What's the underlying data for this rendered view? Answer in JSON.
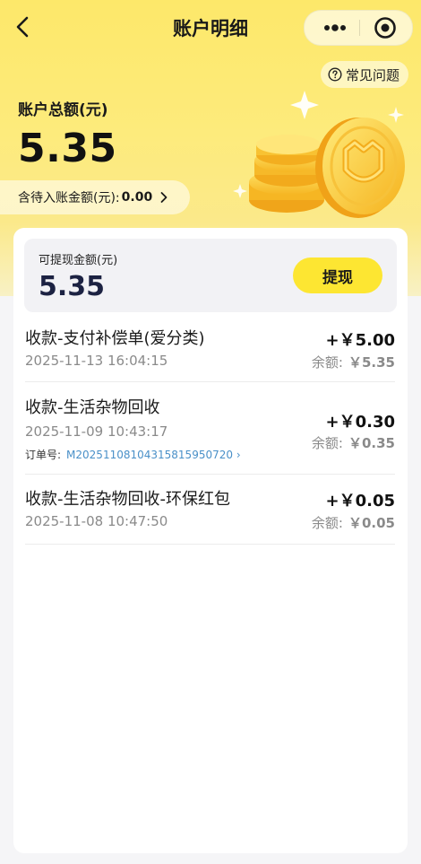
{
  "header": {
    "title": "账户明细"
  },
  "faq": {
    "label": "常见问题"
  },
  "summary": {
    "total_label": "账户总额(元)",
    "total_amount": "5.35",
    "pending_label": "含待入账金额(元):",
    "pending_amount": "0.00"
  },
  "withdraw": {
    "label": "可提现金额(元)",
    "amount": "5.35",
    "button_label": "提现"
  },
  "records": [
    {
      "title": "收款-支付补偿单(爱分类)",
      "time": "2025-11-13 16:04:15",
      "amount": "+￥5.00",
      "balance_label": "余额:",
      "balance": "￥5.35"
    },
    {
      "title": "收款-生活杂物回收",
      "time": "2025-11-09 10:43:17",
      "amount": "+￥0.30",
      "balance_label": "余额:",
      "balance": "￥0.35",
      "order_label": "订单号:",
      "order_no": "M20251108104315815950720 ›"
    },
    {
      "title": "收款-生活杂物回收-环保红包",
      "time": "2025-11-08 10:47:50",
      "amount": "+￥0.05",
      "balance_label": "余额:",
      "balance": "￥0.05"
    }
  ],
  "icons": {
    "back": "chevron-left-icon",
    "more": "more-dots-icon",
    "close_target": "target-icon",
    "faq": "question-circle-icon",
    "pending_arrow": "chevron-right-icon",
    "decoration": "coins-illustration"
  },
  "colors": {
    "accent_yellow": "#fde632",
    "hero_top": "#fde86a",
    "link_blue": "#4a90c8",
    "amount_dark": "#1c2242"
  }
}
